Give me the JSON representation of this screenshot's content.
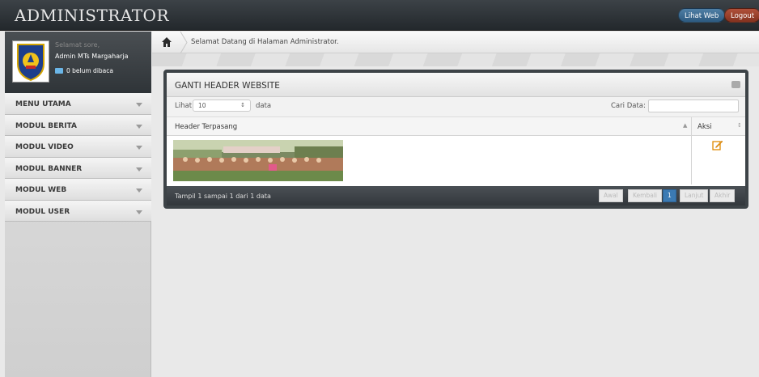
{
  "topbar": {
    "title": "ADMINISTRATOR",
    "view_site_label": "Lihat Web",
    "logout_label": "Logout"
  },
  "sidebar": {
    "greeting": "Selamat sore,",
    "admin_name": "Admin MTs Margaharja",
    "unread_label": "0 belum dibaca",
    "items": [
      {
        "label": "MENU UTAMA"
      },
      {
        "label": "MODUL BERITA"
      },
      {
        "label": "MODUL VIDEO"
      },
      {
        "label": "MODUL BANNER"
      },
      {
        "label": "MODUL WEB"
      },
      {
        "label": "MODUL USER"
      }
    ]
  },
  "breadcrumb": {
    "text": "Selamat Datang di Halaman Administrator."
  },
  "panel": {
    "title": "GANTI HEADER WEBSITE",
    "show_label": "Lihat",
    "page_length": "10",
    "data_label": "data",
    "search_label": "Cari Data:",
    "search_value": "",
    "columns": [
      "Header Terpasang",
      "Aksi"
    ],
    "info": "Tampil 1 sampai 1 dari 1 data",
    "pagination": {
      "first": "Awal",
      "prev": "Kembali",
      "current": "1",
      "next": "Lanjut",
      "last": "Akhir"
    }
  },
  "colors": {
    "topbar": "#2f3438",
    "view_site_button": "#3d6d94",
    "logout_button": "#9a3f2a",
    "active_page": "#3b7ab3",
    "panel_border": "#3d4347"
  }
}
